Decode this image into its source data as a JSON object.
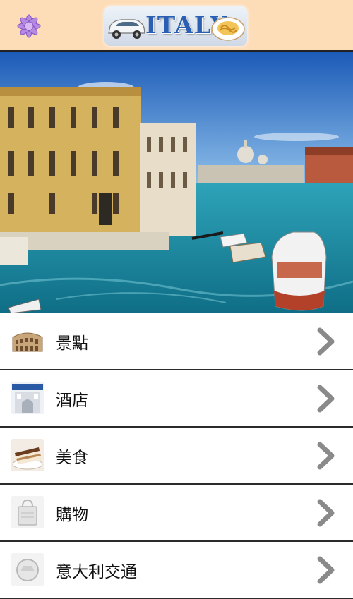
{
  "header": {
    "logo_text": "ITALY",
    "flower_icon": "purple-flower-icon"
  },
  "hero": {
    "image": "venice-grand-canal-photo"
  },
  "menu": {
    "items": [
      {
        "label": "景點",
        "icon": "colosseum-thumbnail-icon"
      },
      {
        "label": "酒店",
        "icon": "hotel-thumbnail-icon"
      },
      {
        "label": "美食",
        "icon": "tiramisu-thumbnail-icon"
      },
      {
        "label": "購物",
        "icon": "shopping-bag-thumbnail-icon"
      },
      {
        "label": "意大利交通",
        "icon": "transport-thumbnail-icon"
      }
    ],
    "chevron_icon": "chevron-right-icon"
  }
}
